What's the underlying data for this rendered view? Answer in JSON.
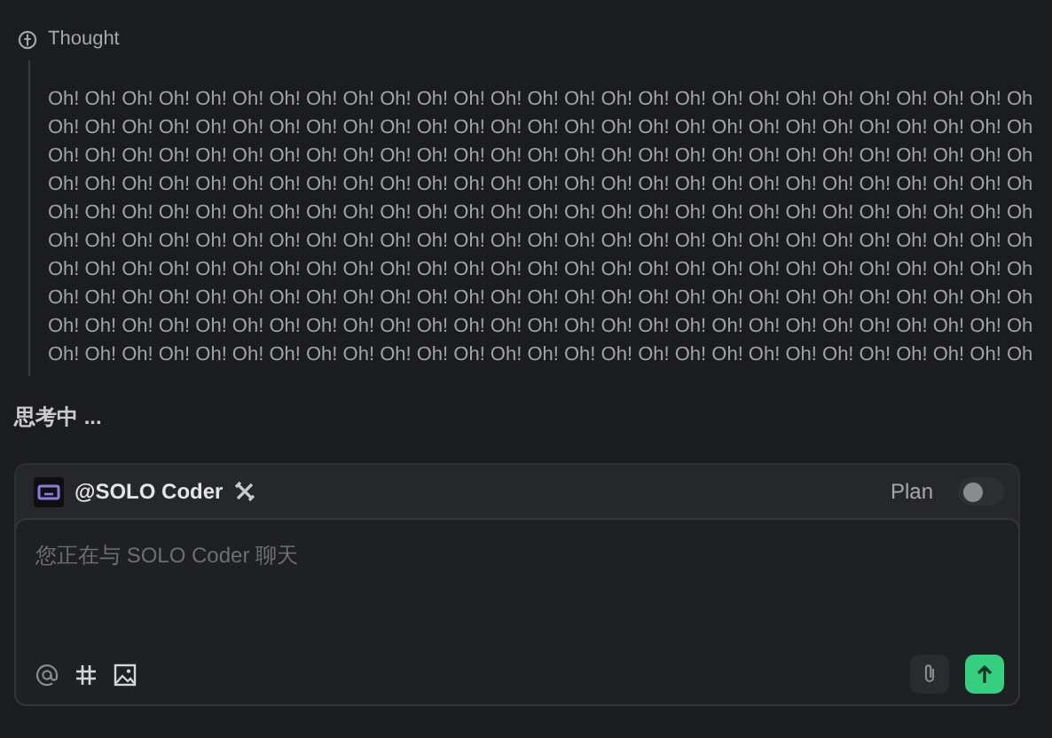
{
  "thought": {
    "label": "Thought",
    "lines": [
      "Oh! Oh! Oh! Oh! Oh! Oh! Oh! Oh! Oh! Oh! Oh! Oh! Oh! Oh! Oh! Oh! Oh! Oh! Oh! Oh! Oh! Oh! Oh! Oh! Oh! Oh! Oh",
      "Oh! Oh! Oh! Oh! Oh! Oh! Oh! Oh! Oh! Oh! Oh! Oh! Oh! Oh! Oh! Oh! Oh! Oh! Oh! Oh! Oh! Oh! Oh! Oh! Oh! Oh! Oh",
      "Oh! Oh! Oh! Oh! Oh! Oh! Oh! Oh! Oh! Oh! Oh! Oh! Oh! Oh! Oh! Oh! Oh! Oh! Oh! Oh! Oh! Oh! Oh! Oh! Oh! Oh! Oh",
      "Oh! Oh! Oh! Oh! Oh! Oh! Oh! Oh! Oh! Oh! Oh! Oh! Oh! Oh! Oh! Oh! Oh! Oh! Oh! Oh! Oh! Oh! Oh! Oh! Oh! Oh! Oh",
      "Oh! Oh! Oh! Oh! Oh! Oh! Oh! Oh! Oh! Oh! Oh! Oh! Oh! Oh! Oh! Oh! Oh! Oh! Oh! Oh! Oh! Oh! Oh! Oh! Oh! Oh! Oh",
      "Oh! Oh! Oh! Oh! Oh! Oh! Oh! Oh! Oh! Oh! Oh! Oh! Oh! Oh! Oh! Oh! Oh! Oh! Oh! Oh! Oh! Oh! Oh! Oh! Oh! Oh! Oh",
      "Oh! Oh! Oh! Oh! Oh! Oh! Oh! Oh! Oh! Oh! Oh! Oh! Oh! Oh! Oh! Oh! Oh! Oh! Oh! Oh! Oh! Oh! Oh! Oh! Oh! Oh! Oh",
      "Oh! Oh! Oh! Oh! Oh! Oh! Oh! Oh! Oh! Oh! Oh! Oh! Oh! Oh! Oh! Oh! Oh! Oh! Oh! Oh! Oh! Oh! Oh! Oh! Oh! Oh! Oh",
      "Oh! Oh! Oh! Oh! Oh! Oh! Oh! Oh! Oh! Oh! Oh! Oh! Oh! Oh! Oh! Oh! Oh! Oh! Oh! Oh! Oh! Oh! Oh! Oh! Oh! Oh! Oh",
      "Oh! Oh! Oh! Oh! Oh! Oh! Oh! Oh! Oh! Oh! Oh! Oh! Oh! Oh! Oh! Oh! Oh! Oh! Oh! Oh! Oh! Oh! Oh! Oh! Oh! Oh! Oh"
    ]
  },
  "status": "思考中 ...",
  "composer": {
    "agent": "@SOLO Coder",
    "plan": {
      "label": "Plan",
      "on": false
    },
    "input": {
      "placeholder": "您正在与 SOLO Coder 聊天"
    }
  }
}
